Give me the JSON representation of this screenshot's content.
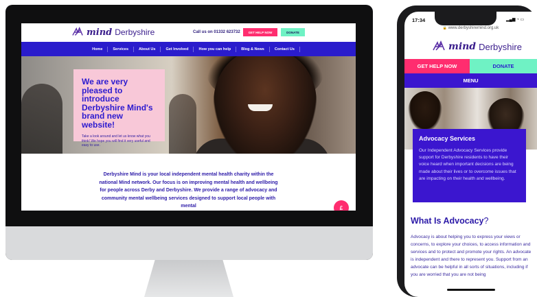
{
  "desktop": {
    "logo_mind": "mind",
    "logo_region": "Derbyshire",
    "call_text": "Call us on 01332 623732",
    "get_help_label": "GET HELP NOW",
    "donate_label": "DONATE",
    "nav": [
      "Home",
      "Services",
      "About Us",
      "Get Involved",
      "How you can help",
      "Blog & News",
      "Contact Us"
    ],
    "hero_title": "We are very pleased to introduce Derbyshire Mind's brand new website!",
    "hero_text": "Take a look around and let us know what you think! We hope you will find it very useful and easy to use.",
    "intro_text": "Derbyshire Mind is your local independent mental health charity within the national Mind network. Our focus is on improving mental health and wellbeing for people across Derby and Derbyshire. We provide a range of advocacy and community mental wellbeing services designed to support local people with mental",
    "chat_badge": "£",
    "colors": {
      "brand_purple": "#3a1d8c",
      "nav_blue": "#2a1ccc",
      "pink": "#ff2d6f",
      "mint": "#6ff2c4",
      "card_pink": "#f8c8d8"
    }
  },
  "mobile": {
    "time": "17:34",
    "status_icons": "signal-wifi-battery-icons",
    "url": "www.derbyshiremind.org.uk",
    "logo_mind": "mind",
    "logo_region": "Derbyshire",
    "get_help_label": "GET HELP NOW",
    "donate_label": "DONATE",
    "menu_label": "MENU",
    "card_title": "Advocacy Services",
    "card_text": "Our Independent Advocacy Services provide support for Derbyshire residents to have their voice heard when important decisions are being made about their lives or to overcome issues that are impacting on their health and wellbeing.",
    "section_title": "What Is Advocacy",
    "section_title_mark": "?",
    "section_text": "Advocacy is about helping you to express your views or concerns, to explore your choices, to access information and services and to protect and promote your rights. An advocate is independent and there to represent you. Support from an advocate can be helpful in all sorts of situations, including if you are worried that you are not being"
  }
}
